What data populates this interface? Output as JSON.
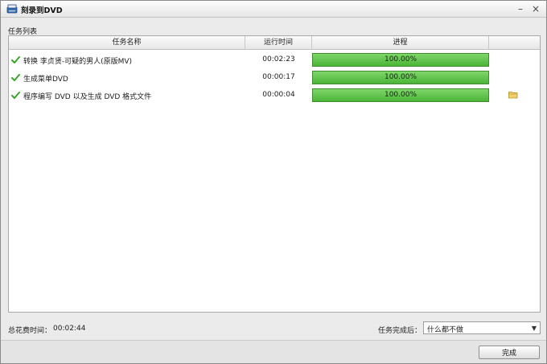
{
  "window": {
    "title": "刻录到DVD",
    "minimize_glyph": "–",
    "close_glyph": "×"
  },
  "task_list": {
    "label": "任务列表",
    "columns": {
      "name": "任务名称",
      "time": "运行时间",
      "progress": "进程",
      "action": ""
    },
    "rows": [
      {
        "name": "转换 李贞贤-可疑的男人(原版MV)",
        "time": "00:02:23",
        "progress_text": "100.00%",
        "progress": 1.0,
        "has_folder": false
      },
      {
        "name": "生成菜单DVD",
        "time": "00:00:17",
        "progress_text": "100.00%",
        "progress": 1.0,
        "has_folder": false
      },
      {
        "name": "程序编写 DVD 以及生成 DVD 格式文件",
        "time": "00:00:04",
        "progress_text": "100.00%",
        "progress": 1.0,
        "has_folder": true
      }
    ]
  },
  "footer": {
    "total_label": "总花费时间：",
    "total_value": "00:02:44",
    "after_label": "任务完成后：",
    "after_value": "什么都不做"
  },
  "buttons": {
    "done": "完成"
  },
  "colors": {
    "progress_fill": "#5cc448",
    "progress_border": "#3e8e2e",
    "check": "#3aa52a",
    "folder": "#e8c25a"
  },
  "icons": {
    "app": "dvd-burner-icon",
    "check": "checkmark-icon",
    "folder": "folder-icon",
    "dropdown": "chevron-down-icon"
  }
}
